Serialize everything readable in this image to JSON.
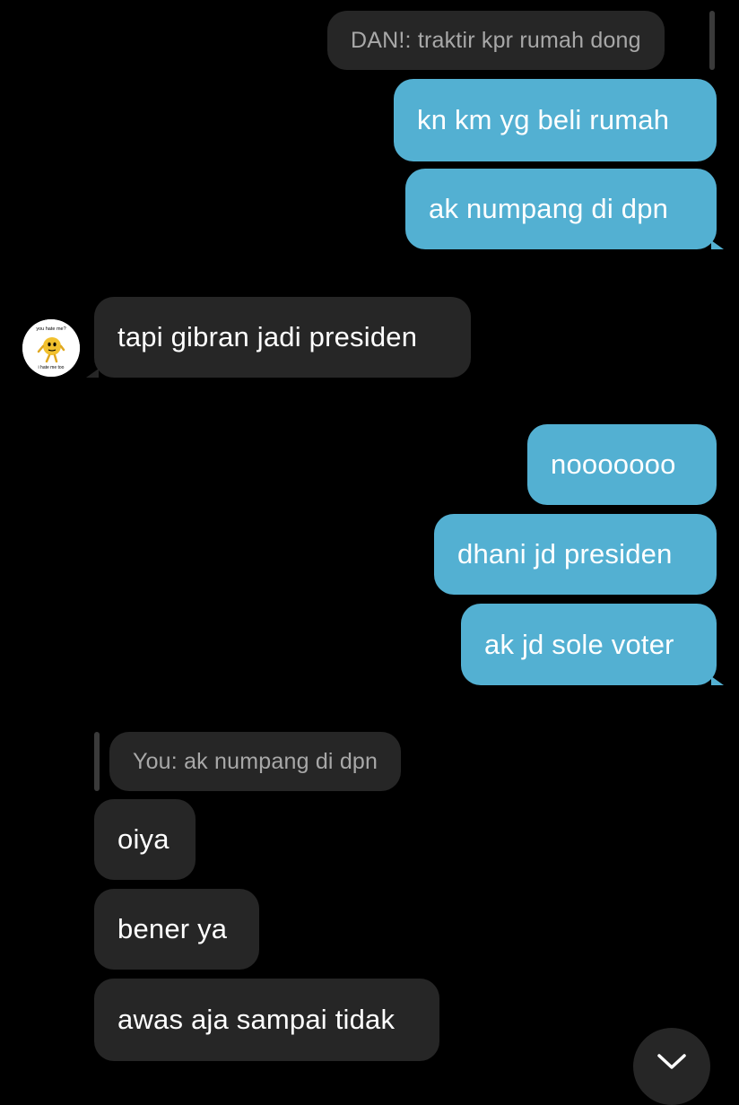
{
  "messages": [
    {
      "id": "m1",
      "kind": "reply-preview",
      "text": "DAN!: traktir kpr rumah dong"
    },
    {
      "id": "m2",
      "kind": "outgoing",
      "text": "kn km yg beli rumah"
    },
    {
      "id": "m3",
      "kind": "outgoing",
      "text": "ak numpang di dpn"
    },
    {
      "id": "m4",
      "kind": "incoming",
      "text": "tapi gibran jadi presiden"
    },
    {
      "id": "m5",
      "kind": "outgoing",
      "text": "nooooooo"
    },
    {
      "id": "m6",
      "kind": "outgoing",
      "text": "dhani jd presiden"
    },
    {
      "id": "m7",
      "kind": "outgoing",
      "text": "ak jd sole voter"
    },
    {
      "id": "m8",
      "kind": "reply-preview",
      "text": "You: ak numpang di dpn"
    },
    {
      "id": "m9",
      "kind": "incoming",
      "text": "oiya"
    },
    {
      "id": "m10",
      "kind": "incoming",
      "text": "bener ya"
    },
    {
      "id": "m11",
      "kind": "incoming",
      "text": "awas aja sampai tidak"
    }
  ],
  "avatar": {
    "icon": "emoji-sticker-avatar-icon",
    "caption_top": "you hate me?",
    "caption_bottom": "i hate me too"
  },
  "controls": {
    "scroll_down_icon": "chevron-down-icon"
  },
  "colors": {
    "background": "#000000",
    "outgoing_bubble": "#53b0d2",
    "incoming_bubble": "#262626",
    "reply_text": "#a8a8a8",
    "text": "#ffffff"
  }
}
